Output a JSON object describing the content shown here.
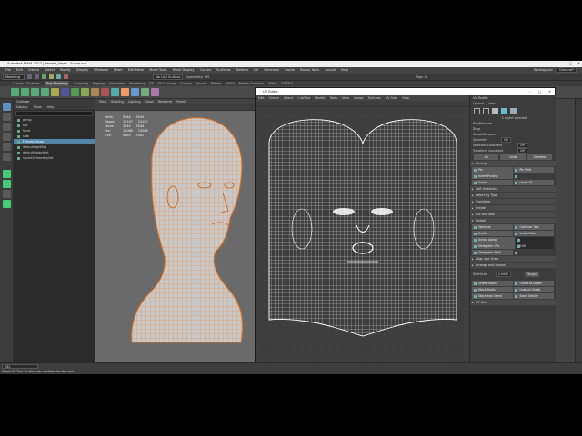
{
  "window": {
    "title": "Autodesk MAYA 2022 | Female_Head - Scene.mb",
    "controls": [
      "–",
      "□",
      "✕"
    ]
  },
  "menubar": {
    "items": [
      "File",
      "Edit",
      "Create",
      "Select",
      "Modify",
      "Display",
      "Windows",
      "Mesh",
      "Edit Mesh",
      "Mesh Tools",
      "Mesh Display",
      "Curves",
      "Surfaces",
      "Deform",
      "UV",
      "Generate",
      "Cache",
      "Bonus Tools",
      "Arnold",
      "Help"
    ],
    "workspace_label": "Workspace:",
    "workspace_value": "General*"
  },
  "status_line": {
    "mode": "Modeling",
    "live_surface": "No Live Surface",
    "symmetry": "Symmetry: Off",
    "login": "Sign In"
  },
  "shelf": {
    "tabs": [
      "Curves / Surfaces",
      "Poly Modeling",
      "Sculpting",
      "Rigging",
      "Animation",
      "Rendering",
      "FX",
      "FX Caching",
      "Custom",
      "Arnold",
      "Bifrost",
      "MASH",
      "Motion Graphics",
      "XGen",
      "TURTLE"
    ],
    "active_tab": "Poly Modeling"
  },
  "outliner": {
    "title": "Outliner",
    "menu": [
      "Display",
      "Show",
      "Help"
    ],
    "items": [
      "persp",
      "top",
      "front",
      "side",
      "Female_Head",
      "defaultLightSet",
      "defaultObjectSet",
      "layoutSymmetrySet"
    ],
    "selected": "Female_Head"
  },
  "viewport": {
    "menu": [
      "View",
      "Shading",
      "Lighting",
      "Show",
      "Renderer",
      "Panels"
    ],
    "hud": [
      {
        "label": "Verts:",
        "a": "5044",
        "b": "5044"
      },
      {
        "label": "Edges:",
        "a": "10107",
        "b": "10107"
      },
      {
        "label": "Faces:",
        "a": "5044",
        "b": "5044"
      },
      {
        "label": "Tris:",
        "a": "10088",
        "b": "10088"
      },
      {
        "label": "UVs:",
        "a": "5385",
        "b": "5385"
      }
    ]
  },
  "uv_editor": {
    "title": "UV Editor",
    "menu": [
      "Edit",
      "Create",
      "Select",
      "Cut/Sew",
      "Modify",
      "Tools",
      "View",
      "Image",
      "Textures",
      "UV Sets",
      "Help"
    ],
    "status": "0 UV shells, 0 overlapping UVs, 0 reversed UVs",
    "colors": {
      "bg": "#3e3e3e",
      "grid": "#4a4a4a",
      "wire": "#e8e8e8"
    }
  },
  "uv_toolkit": {
    "title": "UV Toolkit",
    "menu": [
      "Options",
      "Help"
    ],
    "selected_label": "1 object selected",
    "pick_options": [
      "Pick/Marquee",
      "Drag",
      "Tweak/Marquee"
    ],
    "symmetry_label": "Symmetry",
    "symmetry_value": "Off",
    "selection_constraint": "Selection Constraint",
    "sc_value": "Off",
    "transform_constraint": "Transform Constraint",
    "tc_value": "Off",
    "top_buttons": [
      "All",
      "Circle",
      "Shortest"
    ],
    "pinning_section": "Pinning",
    "pin_buttons": [
      [
        "Pin",
        "Pin Field"
      ],
      [
        "Invert Pinning",
        ""
      ],
      [
        "Unpin",
        "Unpin All"
      ]
    ],
    "soft_selection": "Soft Selection",
    "sections_a": [
      "Select By Type",
      "Transform",
      "Create",
      "Cut and Sew"
    ],
    "unfold_section": "Unfold",
    "unfold_buttons": [
      [
        "Optimize",
        "Optimize Tool"
      ],
      [
        "Unfold",
        "Unfold Tool"
      ],
      [
        "Unfold Along",
        "U"
      ],
      [
        "Straighten UVs",
        "30.00"
      ],
      [
        "Straighten Shell",
        ""
      ]
    ],
    "sections_b": [
      "Align and Snap",
      "Arrange and Layout"
    ],
    "distribute_label": "Distribute",
    "distribute_value": "0.0000",
    "target_label": "Target",
    "layout_buttons": [
      [
        "Orient Shells",
        "Orient to Edges"
      ],
      [
        "Stack Shells",
        "Unstack Shells"
      ],
      [
        "Stack and Orient",
        "Stack Similar"
      ]
    ],
    "uv_sets": "UV Sets"
  },
  "command_line": {
    "mel_label": "MEL",
    "help_text": "Select UV Tool: Fix the tools available for this tool"
  }
}
